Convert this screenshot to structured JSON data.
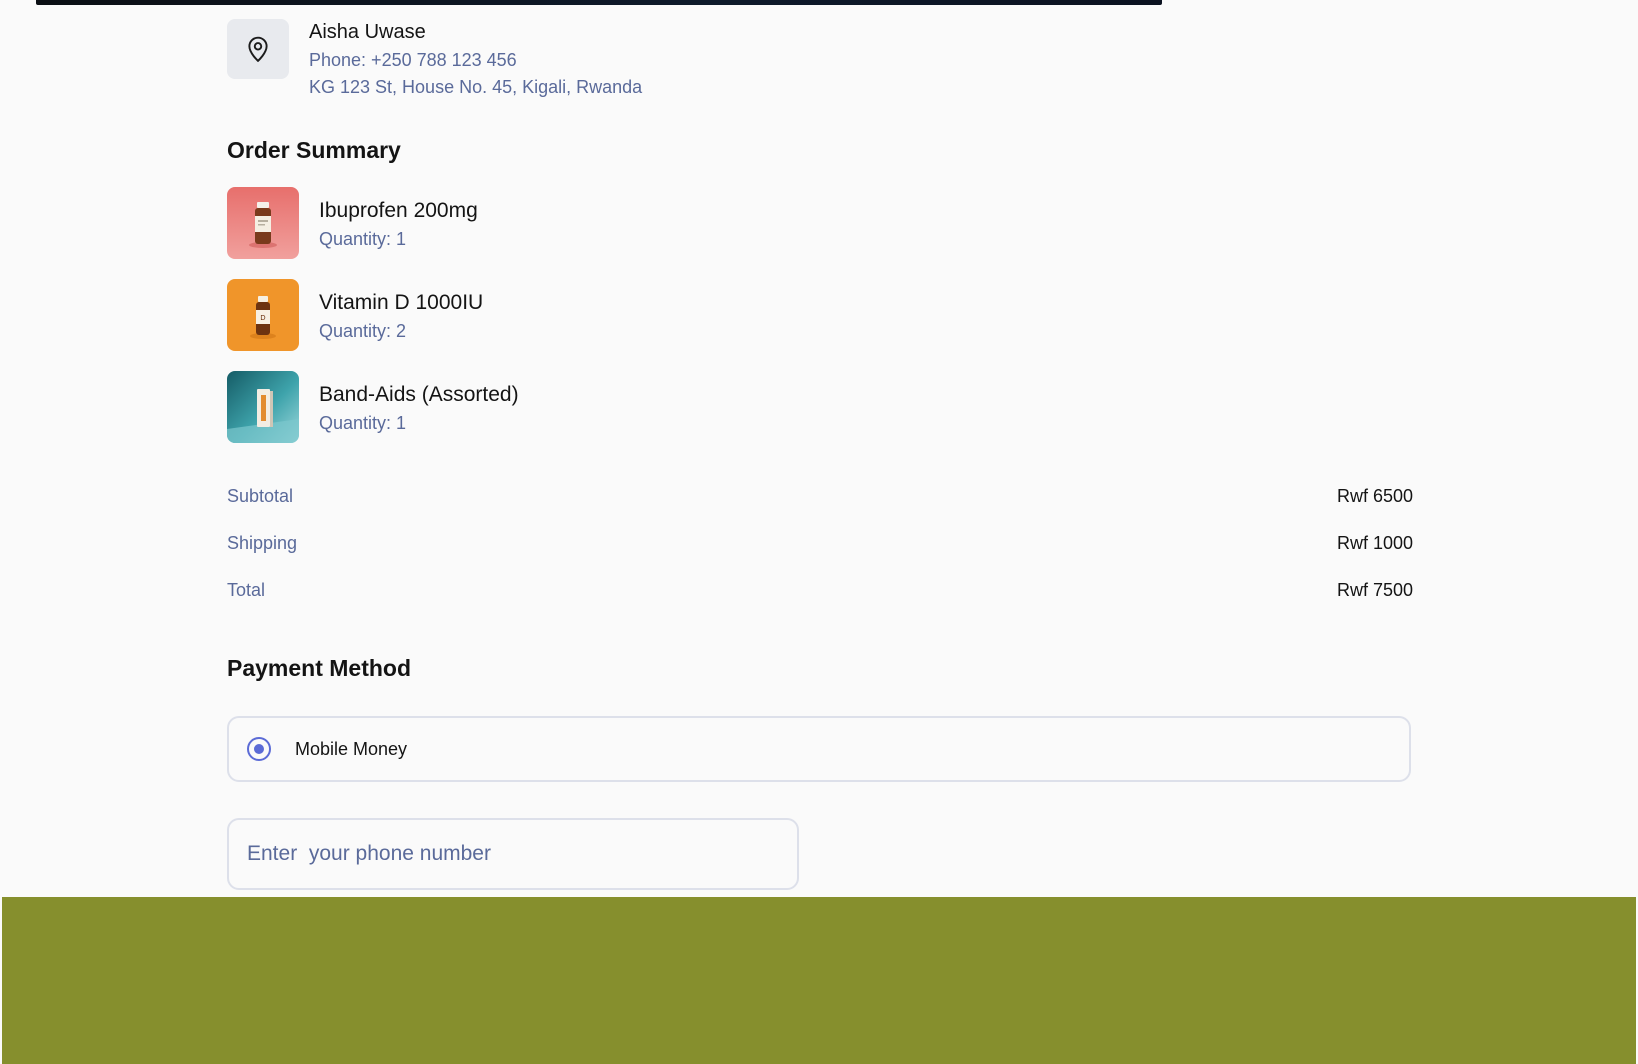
{
  "address": {
    "name": "Aisha Uwase",
    "phone": "Phone: +250 788 123 456",
    "street": "KG 123 St, House No. 45, Kigali, Rwanda",
    "icon": "location-pin-icon"
  },
  "order_summary": {
    "title": "Order Summary",
    "items": [
      {
        "name": "Ibuprofen 200mg",
        "quantity": "Quantity: 1",
        "thumb_color": "#e8716f"
      },
      {
        "name": "Vitamin D 1000IU",
        "quantity": "Quantity: 2",
        "thumb_color": "#f0952a"
      },
      {
        "name": "Band-Aids (Assorted)",
        "quantity": "Quantity: 1",
        "thumb_color": "#2a8f97"
      }
    ]
  },
  "totals": {
    "subtotal_label": "Subtotal",
    "subtotal_value": "Rwf 6500",
    "shipping_label": "Shipping",
    "shipping_value": "Rwf 1000",
    "total_label": "Total",
    "total_value": "Rwf 7500"
  },
  "payment": {
    "title": "Payment Method",
    "selected_option": "Mobile Money",
    "phone_placeholder": "Enter  your phone number",
    "accent_color": "#5b6bd6"
  },
  "colors": {
    "background": "#fafafa",
    "muted_text": "#5a6a9a",
    "bottom_band": "#868f2d"
  }
}
